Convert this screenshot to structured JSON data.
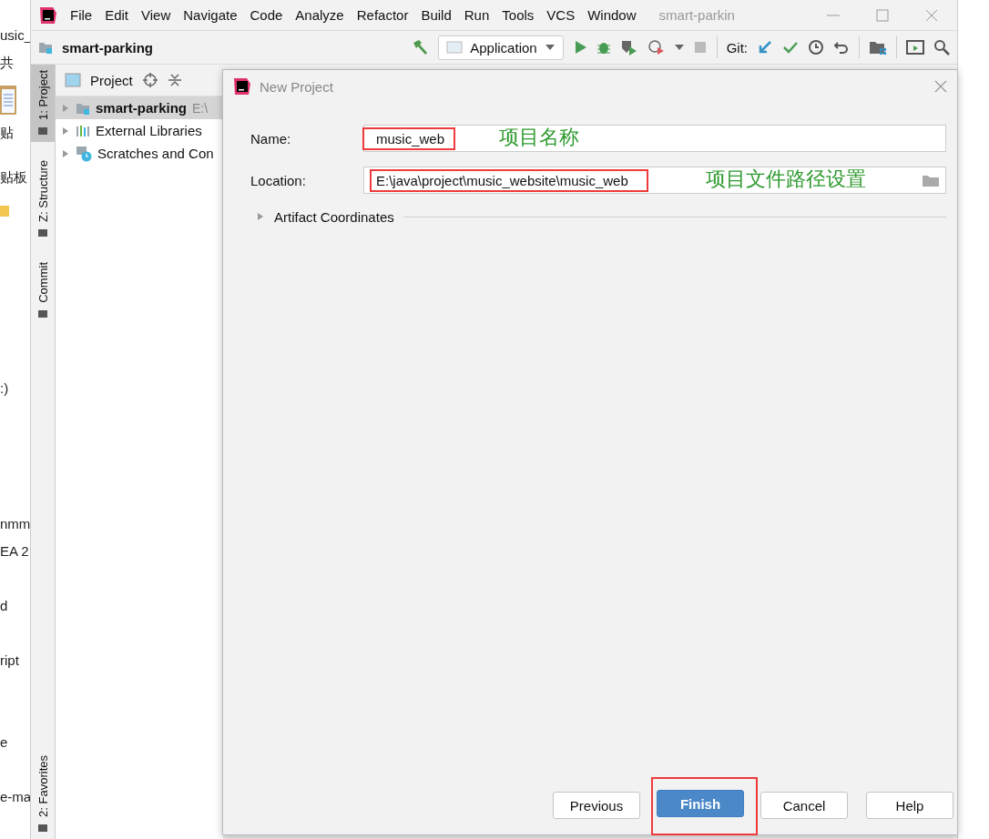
{
  "background_window": {
    "fragments": [
      {
        "text": "usic_",
        "kind": "text"
      },
      {
        "text": "共",
        "kind": "text"
      },
      {
        "kind": "clipboard"
      },
      {
        "text": "贴",
        "kind": "text"
      },
      {
        "text": "贴板",
        "kind": "text"
      },
      {
        "kind": "folder"
      },
      {
        "text": ":)",
        "kind": "text"
      },
      {
        "text": "nmm",
        "kind": "text"
      },
      {
        "text": "EA 2",
        "kind": "text"
      },
      {
        "text": "d",
        "kind": "text"
      },
      {
        "text": "ript",
        "kind": "text"
      },
      {
        "text": "e",
        "kind": "text"
      },
      {
        "text": "e-ma",
        "kind": "text"
      }
    ]
  },
  "ide": {
    "title": "smart-parkin",
    "menu": [
      "File",
      "Edit",
      "View",
      "Navigate",
      "Code",
      "Analyze",
      "Refactor",
      "Build",
      "Run",
      "Tools",
      "VCS",
      "Window"
    ],
    "project_name": "smart-parking",
    "run_config": "Application",
    "git_label": "Git:",
    "tool_tabs": [
      {
        "label": "1: Project",
        "selected": true
      },
      {
        "label": "Z: Structure",
        "selected": false
      },
      {
        "label": "Commit",
        "selected": false
      }
    ],
    "bottom_tool_tabs": [
      {
        "label": "2: Favorites",
        "selected": false
      }
    ],
    "project_panel": {
      "title": "Project",
      "tree": [
        {
          "label": "smart-parking",
          "path": "E:\\",
          "kind": "module",
          "selected": true
        },
        {
          "label": "External Libraries",
          "kind": "libraries",
          "selected": false
        },
        {
          "label": "Scratches and Con",
          "kind": "scratches",
          "selected": false
        }
      ]
    }
  },
  "dialog": {
    "title": "New Project",
    "fields": [
      {
        "label": "Name:",
        "value": "music_web",
        "kind": "text",
        "highlighted": true,
        "annotation": "项目名称"
      },
      {
        "label": "Location:",
        "value": "E:\\java\\project\\music_website\\music_web",
        "kind": "path",
        "highlighted": true,
        "annotation": "项目文件路径设置"
      }
    ],
    "section": {
      "label": "Artifact Coordinates",
      "expanded": false
    },
    "buttons": [
      {
        "label": "Previous",
        "primary": false,
        "highlighted": false
      },
      {
        "label": "Finish",
        "primary": true,
        "highlighted": true
      },
      {
        "label": "Cancel",
        "primary": false,
        "highlighted": false
      },
      {
        "label": "Help",
        "primary": false,
        "highlighted": false
      }
    ]
  }
}
